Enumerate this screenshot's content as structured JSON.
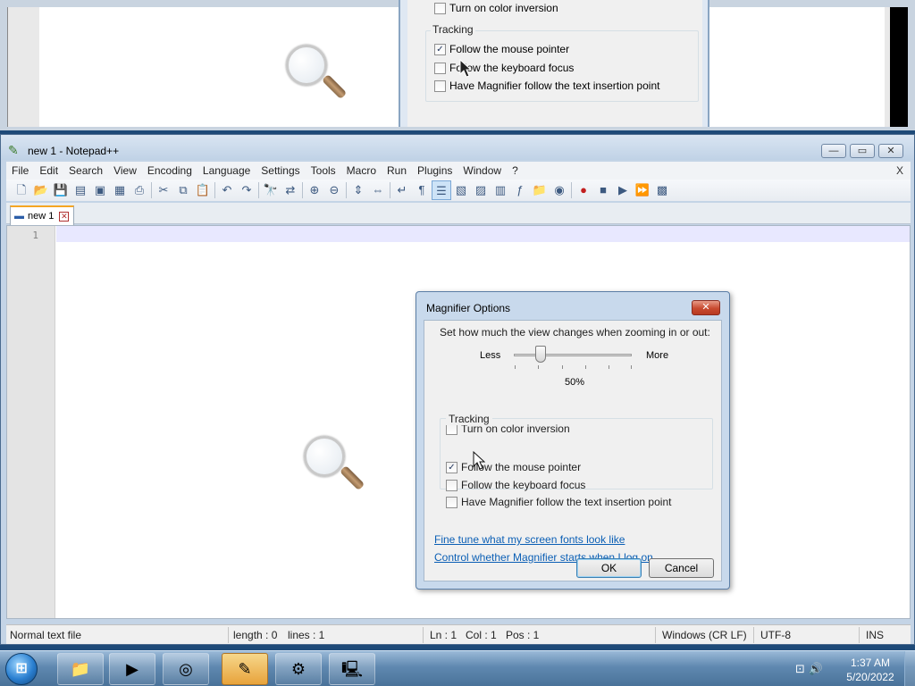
{
  "magnifier": {
    "tracking_title": "Tracking",
    "partial_inversion": "Turn on color inversion",
    "follow_mouse": "Follow the mouse pointer",
    "follow_keyboard": "Follow the keyboard focus",
    "follow_text": "Have Magnifier follow the text insertion point"
  },
  "window": {
    "title": "new 1 - Notepad++",
    "min_glyph": "—",
    "max_glyph": "▭",
    "close_glyph": "✕"
  },
  "menu": {
    "items": [
      "File",
      "Edit",
      "Search",
      "View",
      "Encoding",
      "Language",
      "Settings",
      "Tools",
      "Macro",
      "Run",
      "Plugins",
      "Window",
      "?"
    ],
    "close_x": "X"
  },
  "tab": {
    "label": "new 1",
    "close": "✕"
  },
  "editor": {
    "line_number": "1"
  },
  "status": {
    "file_type": "Normal text file",
    "length": "length : 0",
    "lines": "lines : 1",
    "ln": "Ln : 1",
    "col": "Col : 1",
    "pos": "Pos : 1",
    "eol": "Windows (CR LF)",
    "encoding": "UTF-8",
    "mode": "INS"
  },
  "dialog": {
    "title": "Magnifier Options",
    "close_glyph": "✕",
    "instruction": "Set how much the view changes when zooming in or out:",
    "less": "Less",
    "more": "More",
    "zoom_value": "50%",
    "zoom_level": 0.25,
    "color_inversion": {
      "label": "Turn on color inversion",
      "checked": false
    },
    "tracking_title": "Tracking",
    "follow_mouse": {
      "label": "Follow the mouse pointer",
      "checked": true
    },
    "follow_keyboard": {
      "label": "Follow the keyboard focus",
      "checked": false
    },
    "follow_text": {
      "label": "Have Magnifier follow the text insertion point",
      "checked": false
    },
    "link_fonts": "Fine tune what my screen fonts look like",
    "link_logon": "Control whether Magnifier starts when I log on.",
    "ok": "OK",
    "cancel": "Cancel",
    "check_glyph": "✓"
  },
  "taskbar": {
    "start_glyph": "⊞",
    "time": "1:37 AM",
    "date": "5/20/2022",
    "tray": "⊡ 🔊"
  }
}
